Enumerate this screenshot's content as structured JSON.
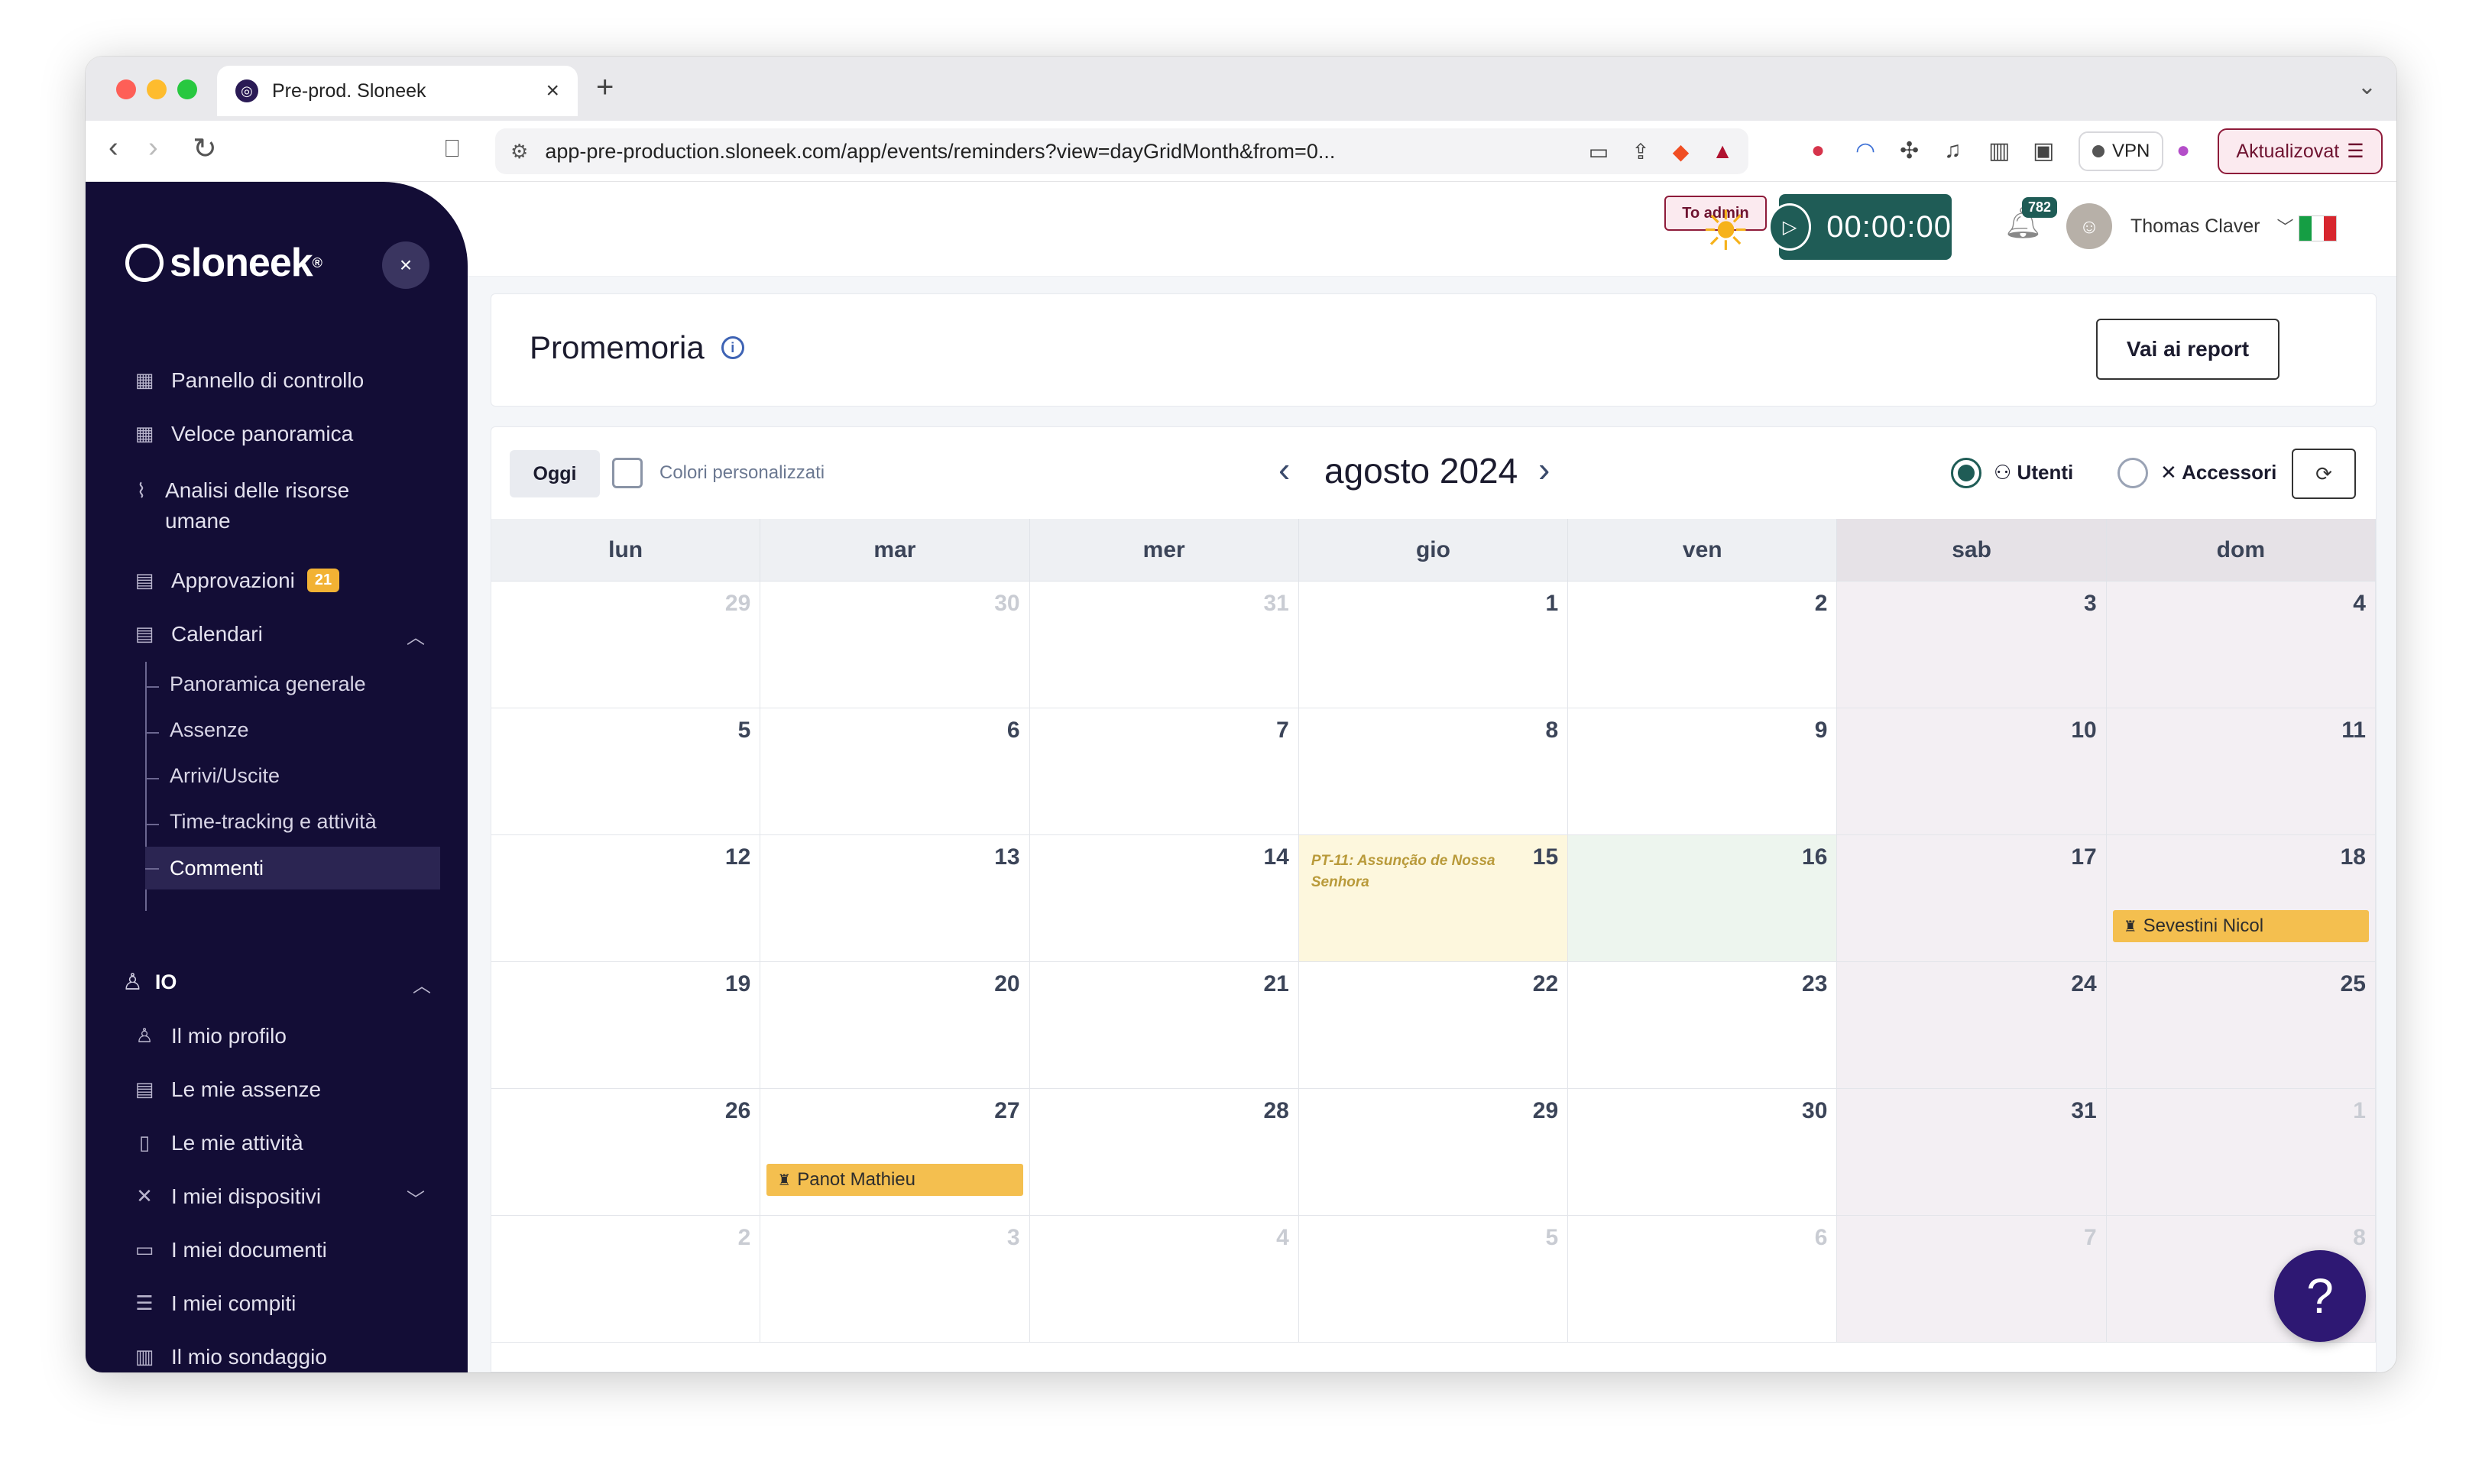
{
  "browser": {
    "tab_title": "Pre-prod. Sloneek",
    "url": "app-pre-production.sloneek.com/app/events/reminders?view=dayGridMonth&from=0...",
    "vpn_label": "VPN",
    "update_label": "Aktualizovat"
  },
  "sidebar": {
    "logo": "sloneek",
    "items": [
      {
        "label": "Pannello di controllo",
        "icon": "dashboard-icon"
      },
      {
        "label": "Veloce panoramica",
        "icon": "grid-icon"
      },
      {
        "label": "Analisi delle risorse umane",
        "icon": "analytics-icon"
      },
      {
        "label": "Approvazioni",
        "icon": "clipboard-icon",
        "badge": "21"
      },
      {
        "label": "Calendari",
        "icon": "calendar-icon"
      }
    ],
    "calendar_sub": [
      {
        "label": "Panoramica generale"
      },
      {
        "label": "Assenze"
      },
      {
        "label": "Arrivi/Uscite"
      },
      {
        "label": "Time-tracking e attività"
      },
      {
        "label": "Commenti"
      }
    ],
    "io_label": "IO",
    "io_items": [
      {
        "label": "Il mio profilo",
        "icon": "user-icon"
      },
      {
        "label": "Le mie assenze",
        "icon": "calendar-x-icon"
      },
      {
        "label": "Le mie attività",
        "icon": "book-icon"
      },
      {
        "label": "I miei dispositivi",
        "icon": "tools-icon"
      },
      {
        "label": "I miei documenti",
        "icon": "folder-icon"
      },
      {
        "label": "I miei compiti",
        "icon": "checklist-icon"
      },
      {
        "label": "Il mio sondaggio",
        "icon": "chart-icon"
      }
    ]
  },
  "topbar": {
    "to_admin": "To admin",
    "timer": "00:00:00",
    "notifications": "782",
    "user_name": "Thomas Claver"
  },
  "page": {
    "title": "Promemoria",
    "report_button": "Vai ai report"
  },
  "calendar": {
    "today_button": "Oggi",
    "custom_colors_label": "Colori personalizzati",
    "month_title": "agosto 2024",
    "filter_users": "Utenti",
    "filter_accessories": "Accessori",
    "weekdays": [
      "lun",
      "mar",
      "mer",
      "gio",
      "ven",
      "sab",
      "dom"
    ],
    "weeks": [
      [
        {
          "d": "29",
          "o": true
        },
        {
          "d": "30",
          "o": true
        },
        {
          "d": "31",
          "o": true
        },
        {
          "d": "1"
        },
        {
          "d": "2"
        },
        {
          "d": "3"
        },
        {
          "d": "4"
        }
      ],
      [
        {
          "d": "5"
        },
        {
          "d": "6"
        },
        {
          "d": "7"
        },
        {
          "d": "8"
        },
        {
          "d": "9"
        },
        {
          "d": "10"
        },
        {
          "d": "11"
        }
      ],
      [
        {
          "d": "12"
        },
        {
          "d": "13"
        },
        {
          "d": "14"
        },
        {
          "d": "15",
          "holiday": "PT-11: Assunção de Nossa Senhora"
        },
        {
          "d": "16",
          "today": true
        },
        {
          "d": "17"
        },
        {
          "d": "18",
          "event": "Sevestini Nicol"
        }
      ],
      [
        {
          "d": "19"
        },
        {
          "d": "20"
        },
        {
          "d": "21"
        },
        {
          "d": "22"
        },
        {
          "d": "23"
        },
        {
          "d": "24"
        },
        {
          "d": "25"
        }
      ],
      [
        {
          "d": "26"
        },
        {
          "d": "27",
          "event": "Panot Mathieu"
        },
        {
          "d": "28"
        },
        {
          "d": "29"
        },
        {
          "d": "30"
        },
        {
          "d": "31"
        },
        {
          "d": "1",
          "o": true
        }
      ],
      [
        {
          "d": "2",
          "o": true
        },
        {
          "d": "3",
          "o": true
        },
        {
          "d": "4",
          "o": true
        },
        {
          "d": "5",
          "o": true
        },
        {
          "d": "6",
          "o": true
        },
        {
          "d": "7",
          "o": true
        },
        {
          "d": "8",
          "o": true
        }
      ]
    ]
  },
  "help_label": "?"
}
